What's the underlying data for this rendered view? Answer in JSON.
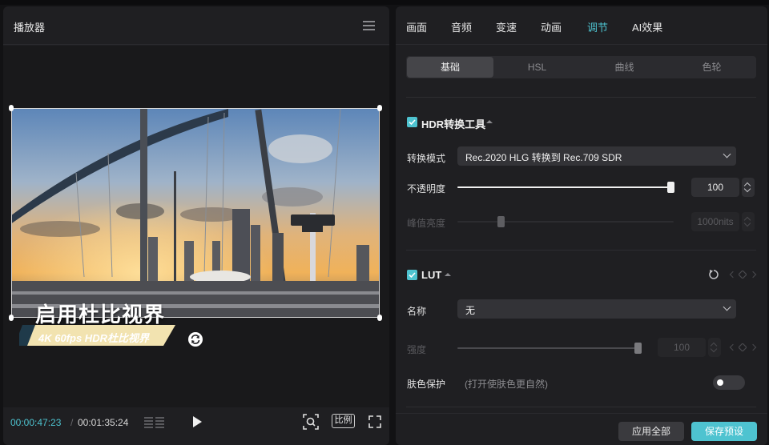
{
  "player": {
    "title": "播放器",
    "current_time": "00:00:47:23",
    "time_separator": "/",
    "total_time": "00:01:35:24",
    "ratio_label": "比例",
    "overlay_title": "启用杜比视界",
    "overlay_subtitle": "4K 60fps HDR杜比视界"
  },
  "adjust": {
    "tabs": [
      "画面",
      "音频",
      "变速",
      "动画",
      "调节",
      "AI效果"
    ],
    "active_tab": "调节",
    "subtabs": [
      "基础",
      "HSL",
      "曲线",
      "色轮"
    ],
    "active_subtab": "基础",
    "hdr": {
      "title": "HDR转换工具",
      "enabled": true,
      "mode_label": "转换模式",
      "mode_value": "Rec.2020 HLG 转换到 Rec.709 SDR",
      "opacity_label": "不透明度",
      "opacity_value": "100",
      "opacity_level": 1.0,
      "peak_label": "峰值亮度",
      "peak_value": "1000nits",
      "peak_level": 0.2
    },
    "lut": {
      "title": "LUT",
      "enabled": true,
      "name_label": "名称",
      "name_value": "无",
      "strength_label": "强度",
      "strength_value": "100",
      "strength_level": 1.0,
      "skin_label": "肤色保护",
      "skin_hint": "(打开使肤色更自然)",
      "skin_enabled": false
    },
    "footer": {
      "apply_all": "应用全部",
      "save_preset": "保存预设"
    }
  },
  "colors": {
    "accent": "#4ec3d0",
    "panel_bg": "#1f1f22",
    "app_bg": "#121214"
  }
}
